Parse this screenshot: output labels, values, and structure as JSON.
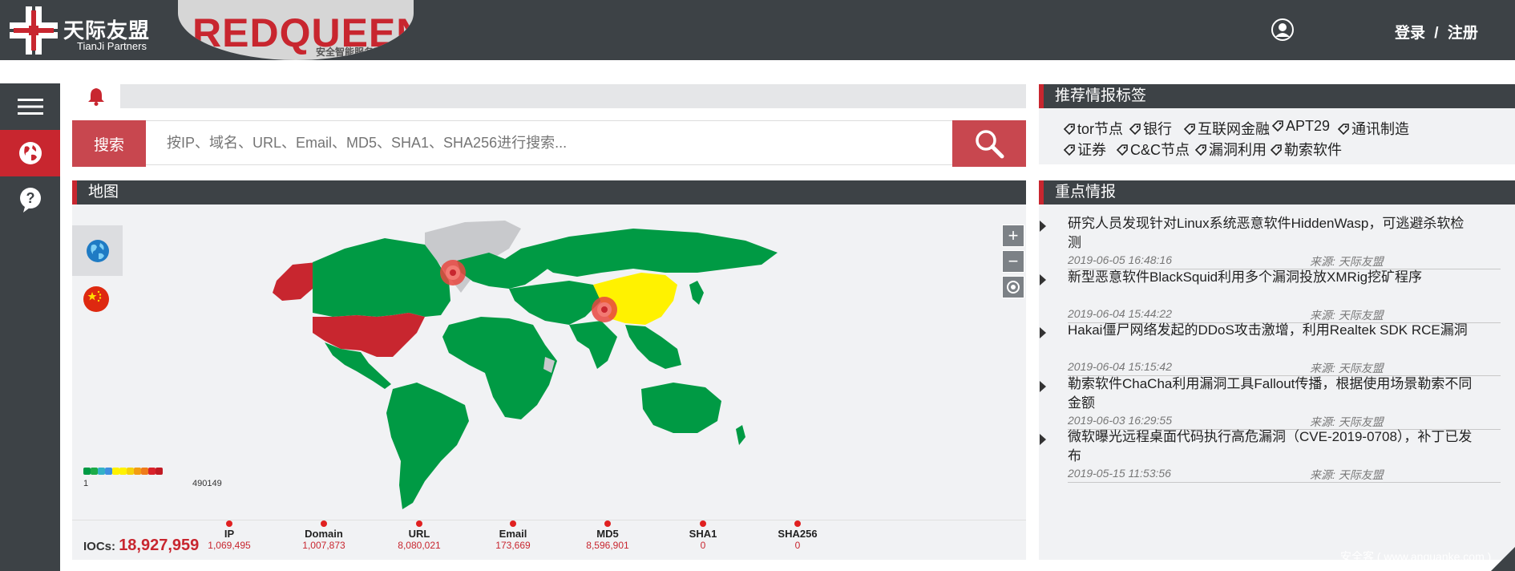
{
  "header": {
    "logo_cn": "天际友盟",
    "logo_en": "TianJi Partners",
    "brand": "REDQUEEN",
    "brand_sub": "安全智能服务平台",
    "login": "登录",
    "separator": "/",
    "register": "注册"
  },
  "sidebar": {
    "items": [
      {
        "icon": "hamburger-menu-icon"
      },
      {
        "icon": "globe-icon",
        "active": true
      },
      {
        "icon": "help-icon"
      }
    ]
  },
  "search": {
    "label": "搜索",
    "placeholder": "按IP、域名、URL、Email、MD5、SHA1、SHA256进行搜索..."
  },
  "map": {
    "title": "地图",
    "legend_min": "1",
    "legend_max": "490149",
    "legend_colors": [
      "#009a44",
      "#1cab48",
      "#33b1c7",
      "#3f8fe0",
      "#fff200",
      "#fff200",
      "#f5d20a",
      "#f29d12",
      "#ef7b1a",
      "#d9222a",
      "#c11a23"
    ],
    "zoom_in": "+",
    "zoom_out": "−",
    "iocs_label": "IOCs:",
    "iocs_total": "18,927,959",
    "stats": [
      {
        "label": "IP",
        "value": "1,069,495"
      },
      {
        "label": "Domain",
        "value": "1,007,873"
      },
      {
        "label": "URL",
        "value": "8,080,021"
      },
      {
        "label": "Email",
        "value": "173,669"
      },
      {
        "label": "MD5",
        "value": "8,596,901"
      },
      {
        "label": "SHA1",
        "value": "0"
      },
      {
        "label": "SHA256",
        "value": "0"
      }
    ]
  },
  "tags": {
    "title": "推荐情报标签",
    "items": [
      "tor节点",
      "银行",
      "互联网金融",
      "APT29",
      "通讯制造",
      "证券",
      "C&C节点",
      "漏洞利用",
      "勒索软件"
    ]
  },
  "news": {
    "title": "重点情报",
    "items": [
      {
        "title": "研究人员发现针对Linux系统恶意软件HiddenWasp，可逃避杀软检测",
        "date": "2019-06-05 16:48:16",
        "source": "来源: 天际友盟"
      },
      {
        "title": "新型恶意软件BlackSquid利用多个漏洞投放XMRig挖矿程序",
        "date": "2019-06-04 15:44:22",
        "source": "来源: 天际友盟"
      },
      {
        "title": "Hakai僵尸网络发起的DDoS攻击激增，利用Realtek SDK RCE漏洞",
        "date": "2019-06-04 15:15:42",
        "source": "来源: 天际友盟"
      },
      {
        "title": "勒索软件ChaCha利用漏洞工具Fallout传播，根据使用场景勒索不同金额",
        "date": "2019-06-03 16:29:55",
        "source": "来源: 天际友盟"
      },
      {
        "title": "微软曝光远程桌面代码执行高危漏洞（CVE-2019-0708），补丁已发布",
        "date": "2019-05-15 11:53:56",
        "source": "来源: 天际友盟"
      }
    ]
  },
  "watermark": "安全客 ( www.anquanke.com )"
}
